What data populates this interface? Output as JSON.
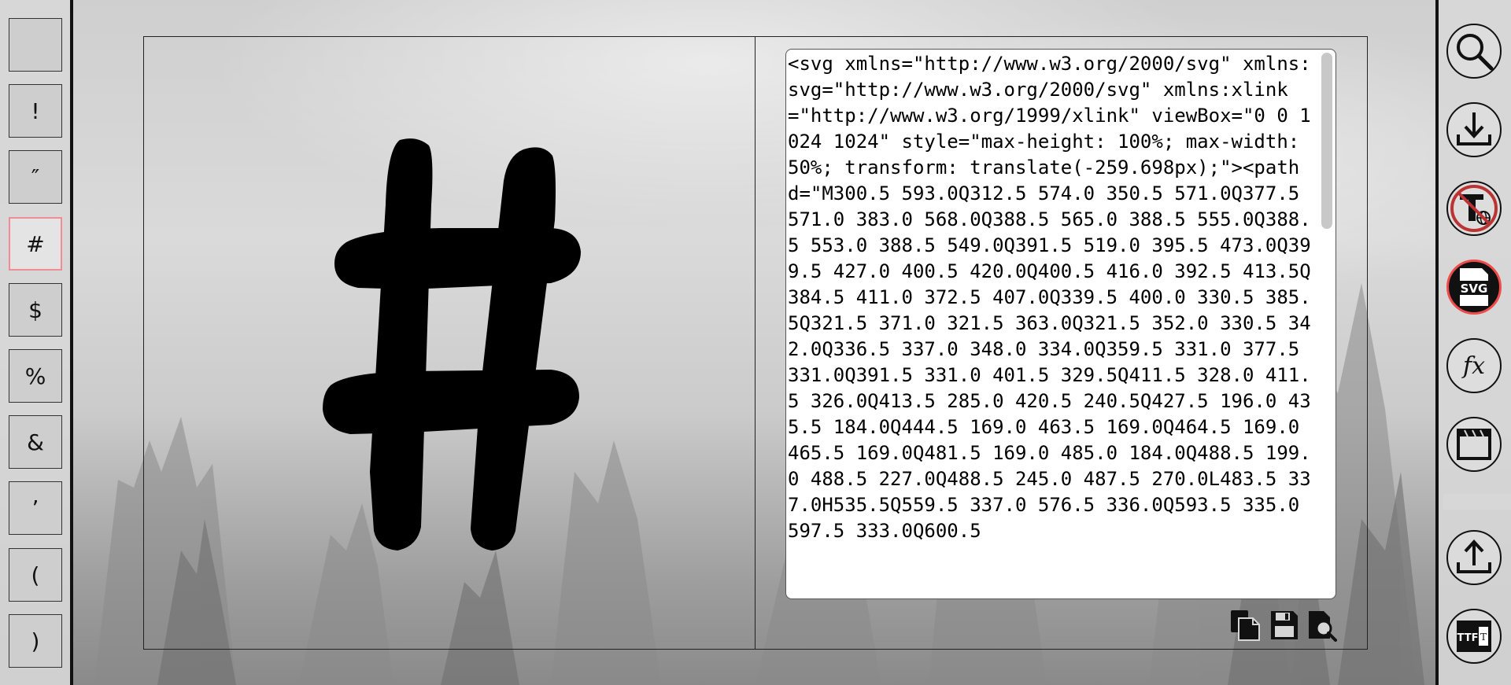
{
  "glyph_list": [
    {
      "char": ""
    },
    {
      "char": "!"
    },
    {
      "char": "″"
    },
    {
      "char": "#"
    },
    {
      "char": "$"
    },
    {
      "char": "%"
    },
    {
      "char": "&"
    },
    {
      "char": "’"
    },
    {
      "char": "("
    },
    {
      "char": ")"
    }
  ],
  "selected_glyph": "#",
  "svg_code": "<svg xmlns=\"http://www.w3.org/2000/svg\" xmlns:svg=\"http://www.w3.org/2000/svg\" xmlns:xlink=\"http://www.w3.org/1999/xlink\" viewBox=\"0 0 1024 1024\" style=\"max-height: 100%; max-width: 50%; transform: translate(-259.698px);\"><path d=\"M300.5 593.0Q312.5 574.0 350.5 571.0Q377.5 571.0 383.0 568.0Q388.5 565.0 388.5 555.0Q388.5 553.0 388.5 549.0Q391.5 519.0 395.5 473.0Q399.5 427.0 400.5 420.0Q400.5 416.0 392.5 413.5Q384.5 411.0 372.5 407.0Q339.5 400.0 330.5 385.5Q321.5 371.0 321.5 363.0Q321.5 352.0 330.5 342.0Q336.5 337.0 348.0 334.0Q359.5 331.0 377.5 331.0Q391.5 331.0 401.5 329.5Q411.5 328.0 411.5 326.0Q413.5 285.0 420.5 240.5Q427.5 196.0 435.5 184.0Q444.5 169.0 463.5 169.0Q464.5 169.0 465.5 169.0Q481.5 169.0 485.0 184.0Q488.5 199.0 488.5 227.0Q488.5 245.0 487.5 270.0L483.5 337.0H535.5Q559.5 337.0 576.5 336.0Q593.5 335.0 597.5 333.0Q600.5",
  "code_actions": [
    {
      "icon": "copy-icon"
    },
    {
      "icon": "save-icon"
    },
    {
      "icon": "preview-search-icon"
    }
  ],
  "toolbar": [
    {
      "icon": "search-icon"
    },
    {
      "icon": "download-icon"
    },
    {
      "icon": "no-text-globe-icon"
    },
    {
      "icon": "svg-icon",
      "label": "SVG",
      "active": true
    },
    {
      "icon": "fx-icon",
      "label": "fx"
    },
    {
      "icon": "window-icon"
    },
    {
      "icon": "upload-icon"
    },
    {
      "icon": "ttf-export-icon",
      "label": "TTF"
    }
  ],
  "colors": {
    "accent_selected": "#f08c94",
    "active_ring": "#ee4b4b"
  }
}
